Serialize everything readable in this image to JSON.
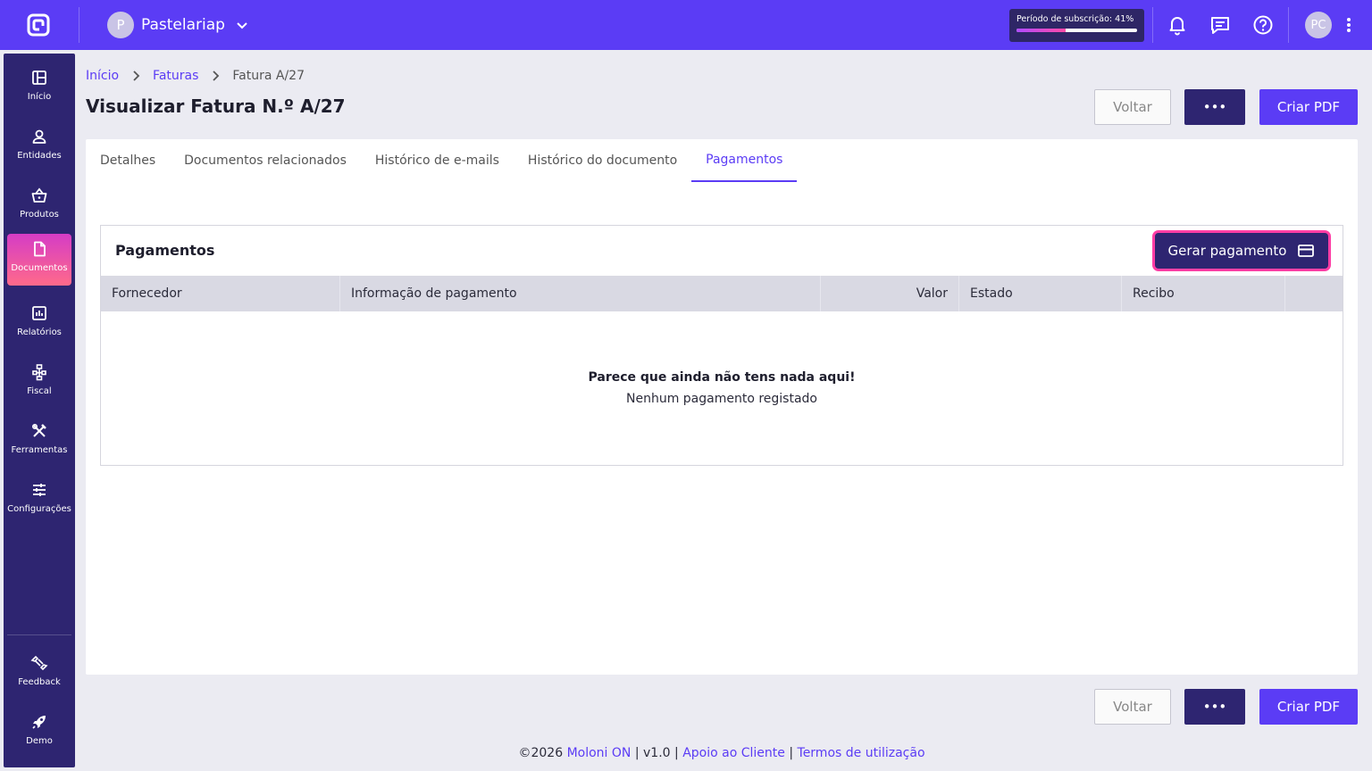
{
  "topbar": {
    "company_initial": "P",
    "company_name": "Pastelariap",
    "subscription_label": "Período de subscrição: 41%",
    "subscription_progress": 0.41,
    "user_initials": "PC",
    "icons": [
      "logo-icon",
      "chevron-down-icon",
      "bell-icon",
      "chat-icon",
      "help-icon",
      "kebab-icon"
    ]
  },
  "sidebar": {
    "items": [
      {
        "label": "Início",
        "icon": "dashboard-icon"
      },
      {
        "label": "Entidades",
        "icon": "user-icon"
      },
      {
        "label": "Produtos",
        "icon": "basket-icon"
      },
      {
        "label": "Documentos",
        "icon": "document-icon",
        "active": true
      },
      {
        "label": "Relatórios",
        "icon": "chart-icon"
      },
      {
        "label": "Fiscal",
        "icon": "hierarchy-icon"
      },
      {
        "label": "Ferramentas",
        "icon": "tools-icon"
      },
      {
        "label": "Configurações",
        "icon": "sliders-icon"
      }
    ],
    "bottom_items": [
      {
        "label": "Feedback",
        "icon": "feedback-icon"
      },
      {
        "label": "Demo",
        "icon": "rocket-icon"
      }
    ]
  },
  "breadcrumb": {
    "items": [
      "Início",
      "Faturas",
      "Fatura A/27"
    ]
  },
  "page": {
    "title": "Visualizar Fatura N.º A/27",
    "back_label": "Voltar",
    "more_label": "•••",
    "pdf_label": "Criar PDF"
  },
  "tabs": [
    {
      "label": "Detalhes"
    },
    {
      "label": "Documentos relacionados"
    },
    {
      "label": "Histórico de e-mails"
    },
    {
      "label": "Histórico do documento"
    },
    {
      "label": "Pagamentos",
      "active": true
    }
  ],
  "payments": {
    "title": "Pagamentos",
    "generate_label": "Gerar pagamento",
    "columns": [
      "Fornecedor",
      "Informação de pagamento",
      "Valor",
      "Estado",
      "Recibo",
      ""
    ],
    "empty_title": "Parece que ainda não tens nada aqui!",
    "empty_subtitle": "Nenhum pagamento registado"
  },
  "footer": {
    "copyright": "©2026",
    "brand": "Moloni ON",
    "separator": "|",
    "version": "v1.0",
    "support": "Apoio ao Cliente",
    "terms": "Termos de utilização"
  },
  "colors": {
    "accent": "#5b3cf5",
    "dark": "#2e2571",
    "highlight": "#ff3ea5"
  }
}
